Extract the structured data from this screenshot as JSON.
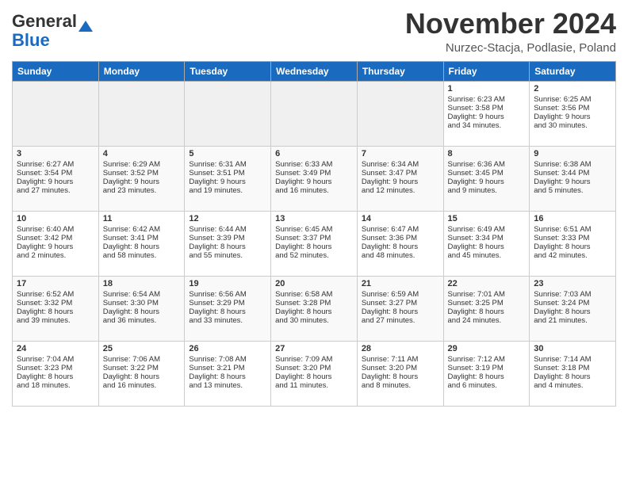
{
  "header": {
    "logo_general": "General",
    "logo_blue": "Blue",
    "month_title": "November 2024",
    "location": "Nurzec-Stacja, Podlasie, Poland"
  },
  "weekdays": [
    "Sunday",
    "Monday",
    "Tuesday",
    "Wednesday",
    "Thursday",
    "Friday",
    "Saturday"
  ],
  "weeks": [
    [
      {
        "day": "",
        "info": ""
      },
      {
        "day": "",
        "info": ""
      },
      {
        "day": "",
        "info": ""
      },
      {
        "day": "",
        "info": ""
      },
      {
        "day": "",
        "info": ""
      },
      {
        "day": "1",
        "info": "Sunrise: 6:23 AM\nSunset: 3:58 PM\nDaylight: 9 hours\nand 34 minutes."
      },
      {
        "day": "2",
        "info": "Sunrise: 6:25 AM\nSunset: 3:56 PM\nDaylight: 9 hours\nand 30 minutes."
      }
    ],
    [
      {
        "day": "3",
        "info": "Sunrise: 6:27 AM\nSunset: 3:54 PM\nDaylight: 9 hours\nand 27 minutes."
      },
      {
        "day": "4",
        "info": "Sunrise: 6:29 AM\nSunset: 3:52 PM\nDaylight: 9 hours\nand 23 minutes."
      },
      {
        "day": "5",
        "info": "Sunrise: 6:31 AM\nSunset: 3:51 PM\nDaylight: 9 hours\nand 19 minutes."
      },
      {
        "day": "6",
        "info": "Sunrise: 6:33 AM\nSunset: 3:49 PM\nDaylight: 9 hours\nand 16 minutes."
      },
      {
        "day": "7",
        "info": "Sunrise: 6:34 AM\nSunset: 3:47 PM\nDaylight: 9 hours\nand 12 minutes."
      },
      {
        "day": "8",
        "info": "Sunrise: 6:36 AM\nSunset: 3:45 PM\nDaylight: 9 hours\nand 9 minutes."
      },
      {
        "day": "9",
        "info": "Sunrise: 6:38 AM\nSunset: 3:44 PM\nDaylight: 9 hours\nand 5 minutes."
      }
    ],
    [
      {
        "day": "10",
        "info": "Sunrise: 6:40 AM\nSunset: 3:42 PM\nDaylight: 9 hours\nand 2 minutes."
      },
      {
        "day": "11",
        "info": "Sunrise: 6:42 AM\nSunset: 3:41 PM\nDaylight: 8 hours\nand 58 minutes."
      },
      {
        "day": "12",
        "info": "Sunrise: 6:44 AM\nSunset: 3:39 PM\nDaylight: 8 hours\nand 55 minutes."
      },
      {
        "day": "13",
        "info": "Sunrise: 6:45 AM\nSunset: 3:37 PM\nDaylight: 8 hours\nand 52 minutes."
      },
      {
        "day": "14",
        "info": "Sunrise: 6:47 AM\nSunset: 3:36 PM\nDaylight: 8 hours\nand 48 minutes."
      },
      {
        "day": "15",
        "info": "Sunrise: 6:49 AM\nSunset: 3:34 PM\nDaylight: 8 hours\nand 45 minutes."
      },
      {
        "day": "16",
        "info": "Sunrise: 6:51 AM\nSunset: 3:33 PM\nDaylight: 8 hours\nand 42 minutes."
      }
    ],
    [
      {
        "day": "17",
        "info": "Sunrise: 6:52 AM\nSunset: 3:32 PM\nDaylight: 8 hours\nand 39 minutes."
      },
      {
        "day": "18",
        "info": "Sunrise: 6:54 AM\nSunset: 3:30 PM\nDaylight: 8 hours\nand 36 minutes."
      },
      {
        "day": "19",
        "info": "Sunrise: 6:56 AM\nSunset: 3:29 PM\nDaylight: 8 hours\nand 33 minutes."
      },
      {
        "day": "20",
        "info": "Sunrise: 6:58 AM\nSunset: 3:28 PM\nDaylight: 8 hours\nand 30 minutes."
      },
      {
        "day": "21",
        "info": "Sunrise: 6:59 AM\nSunset: 3:27 PM\nDaylight: 8 hours\nand 27 minutes."
      },
      {
        "day": "22",
        "info": "Sunrise: 7:01 AM\nSunset: 3:25 PM\nDaylight: 8 hours\nand 24 minutes."
      },
      {
        "day": "23",
        "info": "Sunrise: 7:03 AM\nSunset: 3:24 PM\nDaylight: 8 hours\nand 21 minutes."
      }
    ],
    [
      {
        "day": "24",
        "info": "Sunrise: 7:04 AM\nSunset: 3:23 PM\nDaylight: 8 hours\nand 18 minutes."
      },
      {
        "day": "25",
        "info": "Sunrise: 7:06 AM\nSunset: 3:22 PM\nDaylight: 8 hours\nand 16 minutes."
      },
      {
        "day": "26",
        "info": "Sunrise: 7:08 AM\nSunset: 3:21 PM\nDaylight: 8 hours\nand 13 minutes."
      },
      {
        "day": "27",
        "info": "Sunrise: 7:09 AM\nSunset: 3:20 PM\nDaylight: 8 hours\nand 11 minutes."
      },
      {
        "day": "28",
        "info": "Sunrise: 7:11 AM\nSunset: 3:20 PM\nDaylight: 8 hours\nand 8 minutes."
      },
      {
        "day": "29",
        "info": "Sunrise: 7:12 AM\nSunset: 3:19 PM\nDaylight: 8 hours\nand 6 minutes."
      },
      {
        "day": "30",
        "info": "Sunrise: 7:14 AM\nSunset: 3:18 PM\nDaylight: 8 hours\nand 4 minutes."
      }
    ]
  ]
}
